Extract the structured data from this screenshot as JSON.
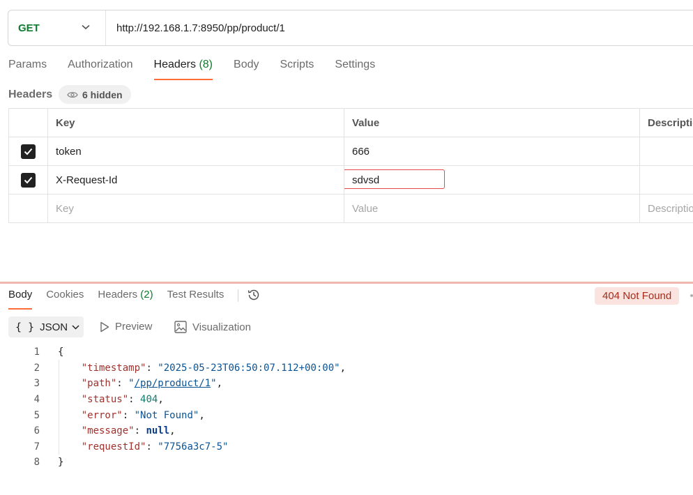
{
  "request": {
    "method": "GET",
    "url": "http://192.168.1.7:8950/pp/product/1"
  },
  "request_tabs": {
    "params": "Params",
    "authorization": "Authorization",
    "headers": "Headers",
    "headers_count": "(8)",
    "body": "Body",
    "scripts": "Scripts",
    "settings": "Settings"
  },
  "headers_section": {
    "title": "Headers",
    "hidden_label": "6 hidden"
  },
  "table": {
    "columns": {
      "key": "Key",
      "value": "Value",
      "description": "Description"
    },
    "rows": [
      {
        "checked": true,
        "key": "token",
        "value": "666"
      },
      {
        "checked": true,
        "key": "X-Request-Id",
        "value": "sdvsd"
      }
    ],
    "placeholders": {
      "key": "Key",
      "value": "Value",
      "description": "Description"
    }
  },
  "response_tabs": {
    "body": "Body",
    "cookies": "Cookies",
    "headers": "Headers",
    "headers_count": "(2)",
    "test_results": "Test Results"
  },
  "status": "404 Not Found",
  "format": {
    "selected": "JSON",
    "braces": "{ }",
    "preview": "Preview",
    "visualization": "Visualization"
  },
  "code": {
    "line_numbers": [
      "1",
      "2",
      "3",
      "4",
      "5",
      "6",
      "7",
      "8"
    ],
    "open": "{",
    "close": "}",
    "fields": [
      {
        "key": "\"timestamp\"",
        "value": "\"2025-05-23T06:50:07.112+00:00\""
      },
      {
        "key": "\"path\"",
        "value_pre": "\"",
        "value_link": "/pp/product/1",
        "value_post": "\""
      },
      {
        "key": "\"status\"",
        "value": "404"
      },
      {
        "key": "\"error\"",
        "value": "\"Not Found\""
      },
      {
        "key": "\"message\"",
        "value": "null"
      },
      {
        "key": "\"requestId\"",
        "value": "\"7756a3c7-5\""
      }
    ]
  },
  "colors": {
    "accent": "#ff6c37",
    "method_green": "#0f7b2e",
    "error_pill_bg": "#fbe4e0",
    "error_pill_text": "#a52b1a",
    "edit_outline": "#e5484d"
  }
}
